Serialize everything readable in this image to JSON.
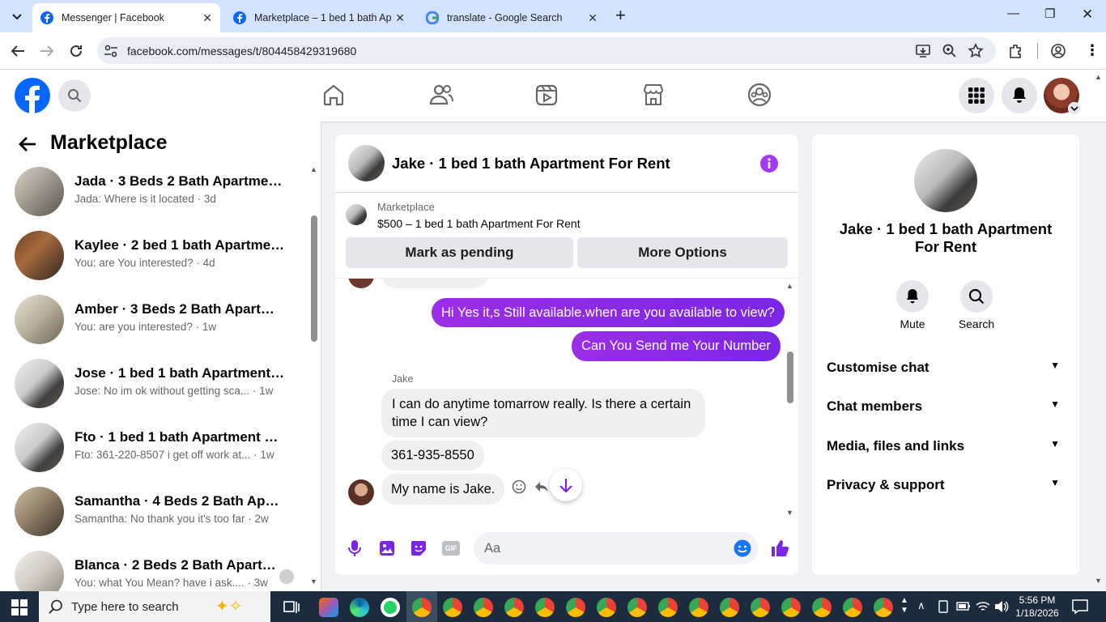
{
  "browser": {
    "tabs": [
      {
        "title": "Messenger | Facebook",
        "active": true
      },
      {
        "title": "Marketplace – 1 bed 1 bath Ap",
        "active": false
      },
      {
        "title": "translate - Google Search",
        "active": false
      }
    ],
    "url": "facebook.com/messages/t/804458429319680"
  },
  "sidebar": {
    "title": "Marketplace",
    "conversations": [
      {
        "name": "Jada · 3 Beds 2 Bath Apartment ...",
        "preview": "Jada: Where is it located · 3d"
      },
      {
        "name": "Kaylee · 2 bed 1 bath Apartment ...",
        "preview": "You: are You interested? · 4d"
      },
      {
        "name": "Amber · 3 Beds 2 Bath Apartme...",
        "preview": "You: are you interested? · 1w"
      },
      {
        "name": "Jose · 1 bed 1 bath Apartment Fo...",
        "preview": "Jose: No im ok without getting sca... · 1w"
      },
      {
        "name": "Fto · 1 bed 1 bath Apartment For...",
        "preview": "Fto: 361-220-8507 i get off work at... · 1w"
      },
      {
        "name": "Samantha · 4 Beds 2 Bath Apart...",
        "preview": "Samantha: No thank you it's too far · 2w"
      },
      {
        "name": "Blanca · 2 Beds 2 Bath Apartm...",
        "preview": "You: what You Mean? have i ask.... · 3w"
      }
    ]
  },
  "chat": {
    "title": "Jake · 1 bed 1 bath Apartment For Rent",
    "listing_label": "Marketplace",
    "listing_title": "$500 – 1 bed 1 bath Apartment For Rent",
    "mark_pending": "Mark as pending",
    "more_options": "More Options",
    "sender": "Jake",
    "messages": [
      {
        "from": "me",
        "text": "Hi Yes it,s Still available.when are you available to view?"
      },
      {
        "from": "me",
        "text": "Can You Send me Your Number"
      },
      {
        "from": "them",
        "text": "I can do anytime tomarrow really. Is there a certain"
      },
      {
        "from": "them",
        "text": "time I can view?"
      },
      {
        "from": "them",
        "text": "361-935-8550"
      },
      {
        "from": "them",
        "text": "My name is Jake."
      }
    ],
    "composer_placeholder": "Aa"
  },
  "details": {
    "title_line1": "Jake · 1 bed 1 bath Apartment",
    "title_line2": "For Rent",
    "mute": "Mute",
    "search": "Search",
    "sections": [
      "Customise chat",
      "Chat members",
      "Media, files and links",
      "Privacy & support"
    ]
  },
  "taskbar": {
    "search_placeholder": "Type here to search",
    "time": "5:56 PM",
    "date": "1/18/2026"
  },
  "colors": {
    "facebook_blue": "#0866ff",
    "messenger_purple": "#8a2be2",
    "header_bg": "#d3e3fd"
  }
}
